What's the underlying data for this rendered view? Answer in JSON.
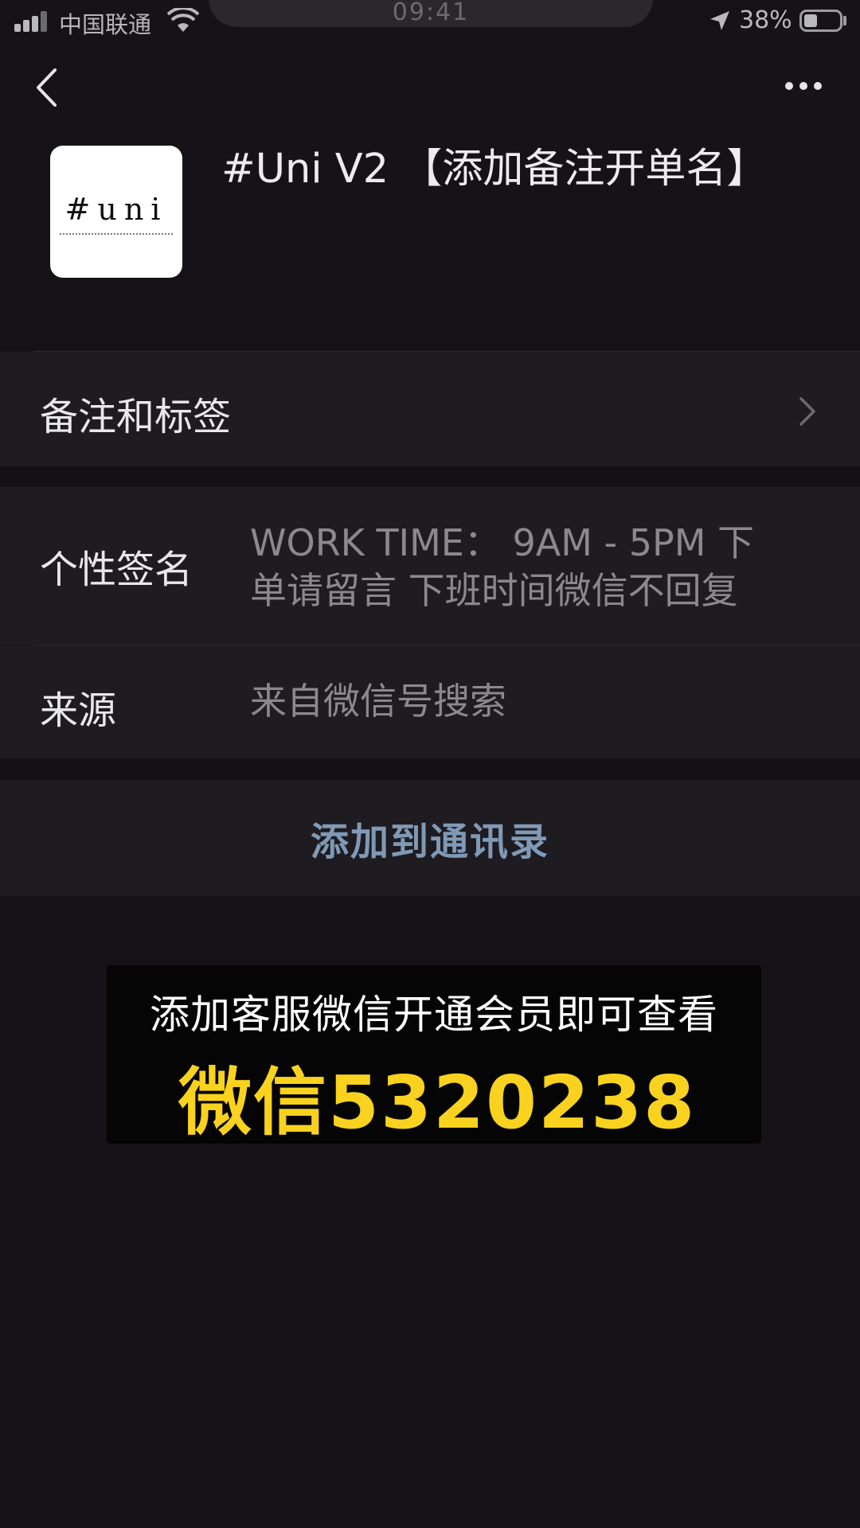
{
  "status_bar": {
    "carrier": "中国联通",
    "time": "09:41",
    "battery_percent": "38%",
    "battery_level": 0.38,
    "icons": [
      "signal-icon",
      "wifi-icon",
      "location-icon",
      "battery-icon"
    ]
  },
  "nav": {
    "back_icon": "chevron-left-icon",
    "more_icon": "more-dots-icon"
  },
  "profile": {
    "name": "#Uni V2 【添加备注开单名】",
    "avatar_logo": "#uni"
  },
  "rows": {
    "remarks_label": "备注和标签",
    "signature_label": "个性签名",
    "signature_value_line1": "WORK TIME： 9AM - 5PM 下",
    "signature_value_line2": "单请留言 下班时间微信不回复",
    "source_label": "来源",
    "source_value": "来自微信号搜索"
  },
  "actions": {
    "add_contact_label": "添加到通讯录"
  },
  "banner": {
    "line1": "添加客服微信开通会员即可查看",
    "line2": "微信5320238"
  },
  "colors": {
    "background": "#161318",
    "row_background": "#1e1c21",
    "link": "#8099b5",
    "banner_highlight": "#f8d21e"
  }
}
